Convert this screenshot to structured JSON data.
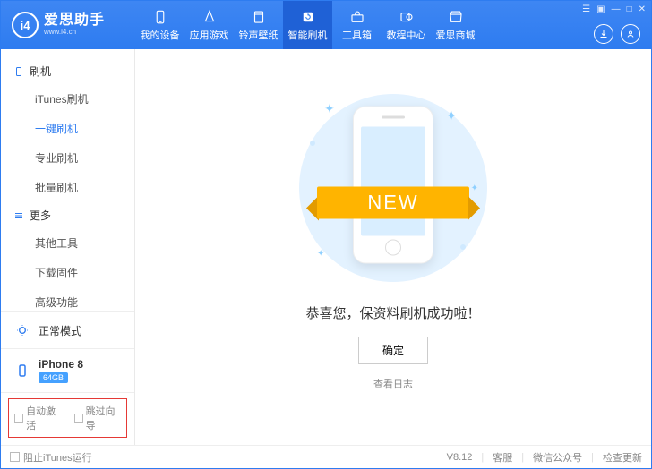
{
  "header": {
    "logo_text": "i4",
    "app_title": "爱思助手",
    "app_sub": "www.i4.cn",
    "nav": [
      {
        "label": "我的设备",
        "icon": "phone"
      },
      {
        "label": "应用游戏",
        "icon": "apps"
      },
      {
        "label": "铃声壁纸",
        "icon": "note"
      },
      {
        "label": "智能刷机",
        "icon": "refresh",
        "active": true
      },
      {
        "label": "工具箱",
        "icon": "toolbox"
      },
      {
        "label": "教程中心",
        "icon": "book"
      },
      {
        "label": "爱思商城",
        "icon": "shop"
      }
    ],
    "window_controls": [
      "☰",
      "▣",
      "—",
      "□",
      "✕"
    ],
    "right_btns": [
      "download",
      "user"
    ]
  },
  "sidebar": {
    "group1_title": "刷机",
    "group1_items": [
      {
        "label": "iTunes刷机"
      },
      {
        "label": "一键刷机",
        "active": true
      },
      {
        "label": "专业刷机"
      },
      {
        "label": "批量刷机"
      }
    ],
    "group2_title": "更多",
    "group2_items": [
      {
        "label": "其他工具"
      },
      {
        "label": "下载固件"
      },
      {
        "label": "高级功能"
      }
    ],
    "mode_label": "正常模式",
    "device_name": "iPhone 8",
    "device_badge": "64GB",
    "opt1": "自动激活",
    "opt2": "跳过向导"
  },
  "main": {
    "ribbon_text": "NEW",
    "success_msg": "恭喜您，保资料刷机成功啦！",
    "ok_label": "确定",
    "log_label": "查看日志"
  },
  "footer": {
    "block_itunes": "阻止iTunes运行",
    "version": "V8.12",
    "support": "客服",
    "wechat": "微信公众号",
    "check_update": "检查更新"
  }
}
